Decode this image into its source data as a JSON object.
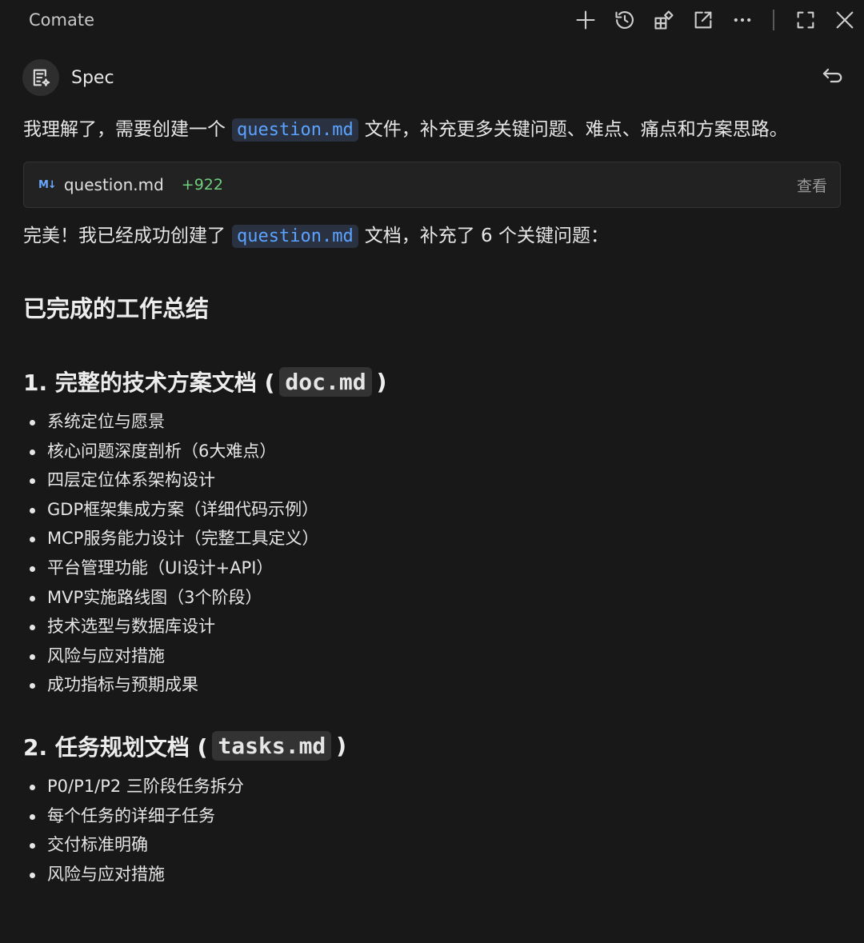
{
  "app": {
    "title": "Comate"
  },
  "mode": {
    "label": "Spec"
  },
  "messages": {
    "intro_before": "我理解了，需要创建一个",
    "intro_code": "question.md",
    "intro_after": "文件，补充更多关键问题、难点、痛点和方案思路。",
    "file_card": {
      "icon": "M↓",
      "name": "question.md",
      "diff": "+922",
      "view_label": "查看"
    },
    "done_before": "完美！我已经成功创建了",
    "done_code": "question.md",
    "done_after": "文档，补充了 6 个关键问题："
  },
  "summary": {
    "heading": "已完成的工作总结",
    "sections": [
      {
        "title_before": "1. 完整的技术方案文档 (",
        "title_code": "doc.md",
        "title_after": ")",
        "items": [
          "系统定位与愿景",
          "核心问题深度剖析（6大难点）",
          "四层定位体系架构设计",
          "GDP框架集成方案（详细代码示例）",
          "MCP服务能力设计（完整工具定义）",
          "平台管理功能（UI设计+API）",
          "MVP实施路线图（3个阶段）",
          "技术选型与数据库设计",
          "风险与应对措施",
          "成功指标与预期成果"
        ]
      },
      {
        "title_before": "2. 任务规划文档 (",
        "title_code": "tasks.md",
        "title_after": ")",
        "items": [
          "P0/P1/P2 三阶段任务拆分",
          "每个任务的详细子任务",
          "交付标准明确",
          "风险与应对措施"
        ]
      }
    ]
  },
  "colors": {
    "background": "#181818",
    "code_accent": "#5ba3ff",
    "diff_green": "#6fcf7f"
  }
}
